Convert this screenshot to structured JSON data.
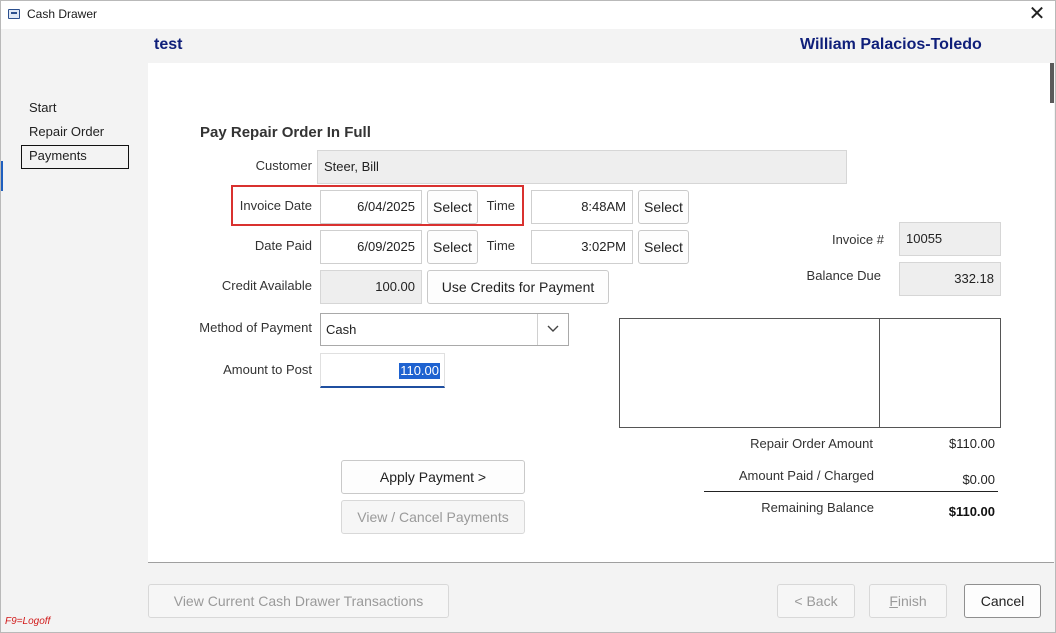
{
  "window": {
    "title": "Cash Drawer"
  },
  "header": {
    "left": "test",
    "right": "William Palacios-Toledo"
  },
  "nav": {
    "items": [
      "Start",
      "Repair Order",
      "Payments"
    ],
    "active_index": 2
  },
  "form": {
    "heading": "Pay Repair Order In Full",
    "customer_label": "Customer",
    "customer_value": "Steer, Bill",
    "invoice_date_label": "Invoice Date",
    "invoice_date_value": "6/04/2025",
    "date_paid_label": "Date Paid",
    "date_paid_value": "6/09/2025",
    "select_label": "Select",
    "time_label": "Time",
    "invoice_time_value": "8:48AM",
    "paid_time_value": "3:02PM",
    "credit_label": "Credit Available",
    "credit_value": "100.00",
    "use_credits_label": "Use Credits for Payment",
    "method_label": "Method of Payment",
    "method_value": "Cash",
    "amount_label": "Amount to Post",
    "amount_value": "110.00",
    "invoice_no_label": "Invoice #",
    "invoice_no_value": "10055",
    "balance_due_label": "Balance Due",
    "balance_due_value": "332.18"
  },
  "summary": {
    "repair_order_amount_label": "Repair Order Amount",
    "repair_order_amount_value": "$110.00",
    "amount_paid_label": "Amount Paid / Charged",
    "amount_paid_value": "$0.00",
    "remaining_label": "Remaining Balance",
    "remaining_value": "$110.00"
  },
  "actions": {
    "apply_payment": "Apply Payment >",
    "view_cancel_payments": "View / Cancel Payments",
    "view_transactions": "View Current Cash Drawer Transactions",
    "back": "< Back",
    "finish_first": "F",
    "finish_rest": "inish",
    "cancel": "Cancel"
  },
  "footer": {
    "logoff_hint": "F9=Logoff"
  },
  "colors": {
    "header_text": "#0f1f7a",
    "highlight": "#d9312f",
    "selection": "#1e62d0",
    "logoff": "#d11b1b"
  }
}
